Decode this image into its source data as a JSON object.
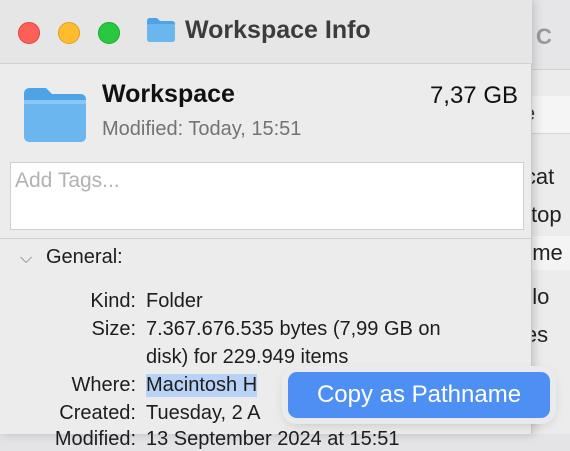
{
  "background_window": {
    "title_fragment": "C",
    "column_header": "e",
    "rows": [
      "icat",
      "ktop",
      "ume",
      "nlo",
      "ies",
      "",
      ""
    ]
  },
  "window": {
    "title": "Workspace Info",
    "icon": "folder-icon"
  },
  "header": {
    "name": "Workspace",
    "size": "7,37 GB",
    "modified_label": "Modified:",
    "modified_value": "Today, 15:51"
  },
  "tags": {
    "placeholder": "Add Tags..."
  },
  "general": {
    "title": "General:",
    "kind_label": "Kind:",
    "kind_value": "Folder",
    "size_label": "Size:",
    "size_line1": "7.367.676.535 bytes (7,99 GB on",
    "size_line2": "disk) for 229.949 items",
    "where_label": "Where:",
    "where_value": "Macintosh H",
    "created_label": "Created:",
    "created_value": "Tuesday, 2 A",
    "modified_label": "Modified:",
    "modified_value": "13 September 2024 at 15:51"
  },
  "context_popup": {
    "label": "Copy as Pathname"
  },
  "colors": {
    "popup_bg": "#4e8ff4",
    "highlight": "#b8d3f6",
    "folder_blue": "#6cb6f0"
  }
}
